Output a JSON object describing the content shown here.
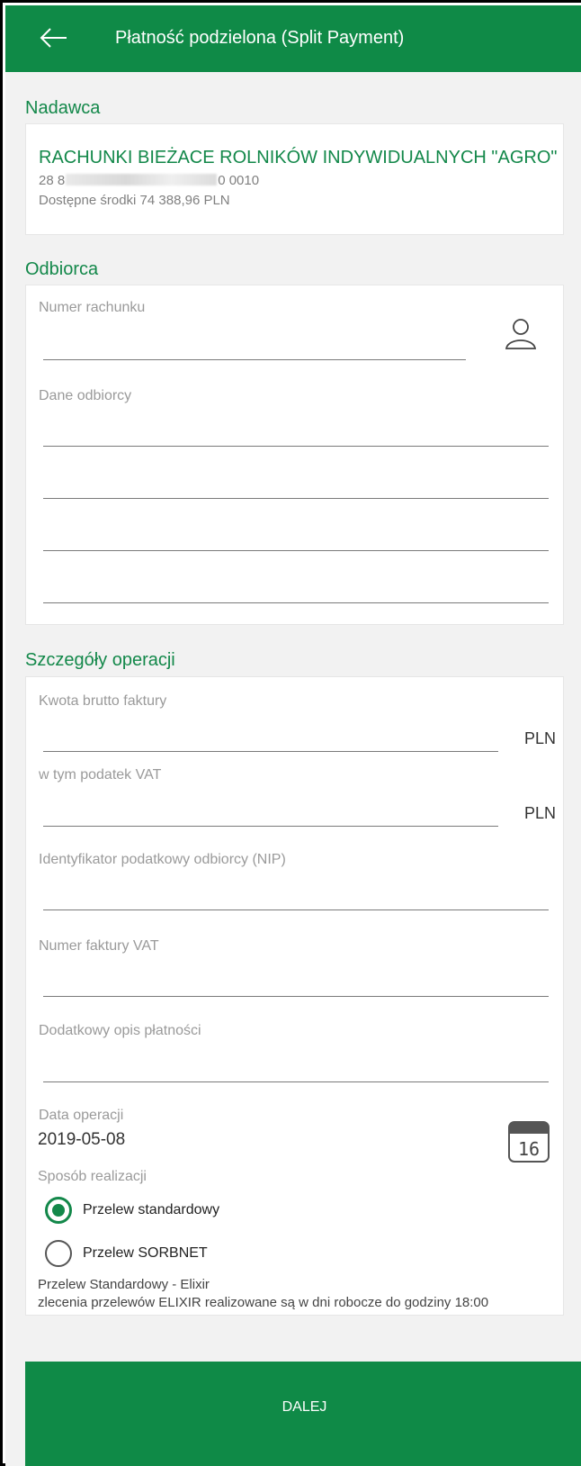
{
  "header": {
    "title": "Płatność podzielona (Split Payment)",
    "back_icon": "arrow-left-icon",
    "background_color": "#0f8a47"
  },
  "sender": {
    "section_title": "Nadawca",
    "account_name": "RACHUNKI BIEŻACE ROLNIKÓW INDYWIDUALNYCH \"AGRO\"",
    "account_number_prefix": "28 8",
    "account_number_suffix": "0 0010",
    "available_funds": "Dostępne środki 74 388,96 PLN"
  },
  "recipient": {
    "section_title": "Odbiorca",
    "account_number_label": "Numer rachunku",
    "account_number_value": "",
    "contacts_icon": "person-icon",
    "recipient_data_label": "Dane odbiorcy",
    "recipient_data_lines": [
      "",
      "",
      "",
      ""
    ]
  },
  "operation": {
    "section_title": "Szczegóły operacji",
    "gross_amount_label": "Kwota brutto faktury",
    "gross_amount_value": "",
    "gross_amount_unit": "PLN",
    "vat_label": "w tym podatek VAT",
    "vat_value": "",
    "vat_unit": "PLN",
    "nip_label": "Identyfikator podatkowy odbiorcy (NIP)",
    "nip_value": "",
    "invoice_number_label": "Numer faktury VAT",
    "invoice_number_value": "",
    "description_label": "Dodatkowy opis płatności",
    "description_value": "",
    "date_label": "Data operacji",
    "date_value": "2019-05-08",
    "calendar_icon": "calendar-icon",
    "calendar_day": "16",
    "method_label": "Sposób realizacji",
    "methods": [
      {
        "label": "Przelew standardowy",
        "selected": true
      },
      {
        "label": "Przelew SORBNET",
        "selected": false
      }
    ],
    "info_line_1": "Przelew Standardowy - Elixir",
    "info_line_2": "zlecenia przelewów ELIXIR realizowane są w dni robocze do godziny 18:00"
  },
  "footer": {
    "next_button_label": "DALEJ",
    "accent_color": "#13884a"
  }
}
